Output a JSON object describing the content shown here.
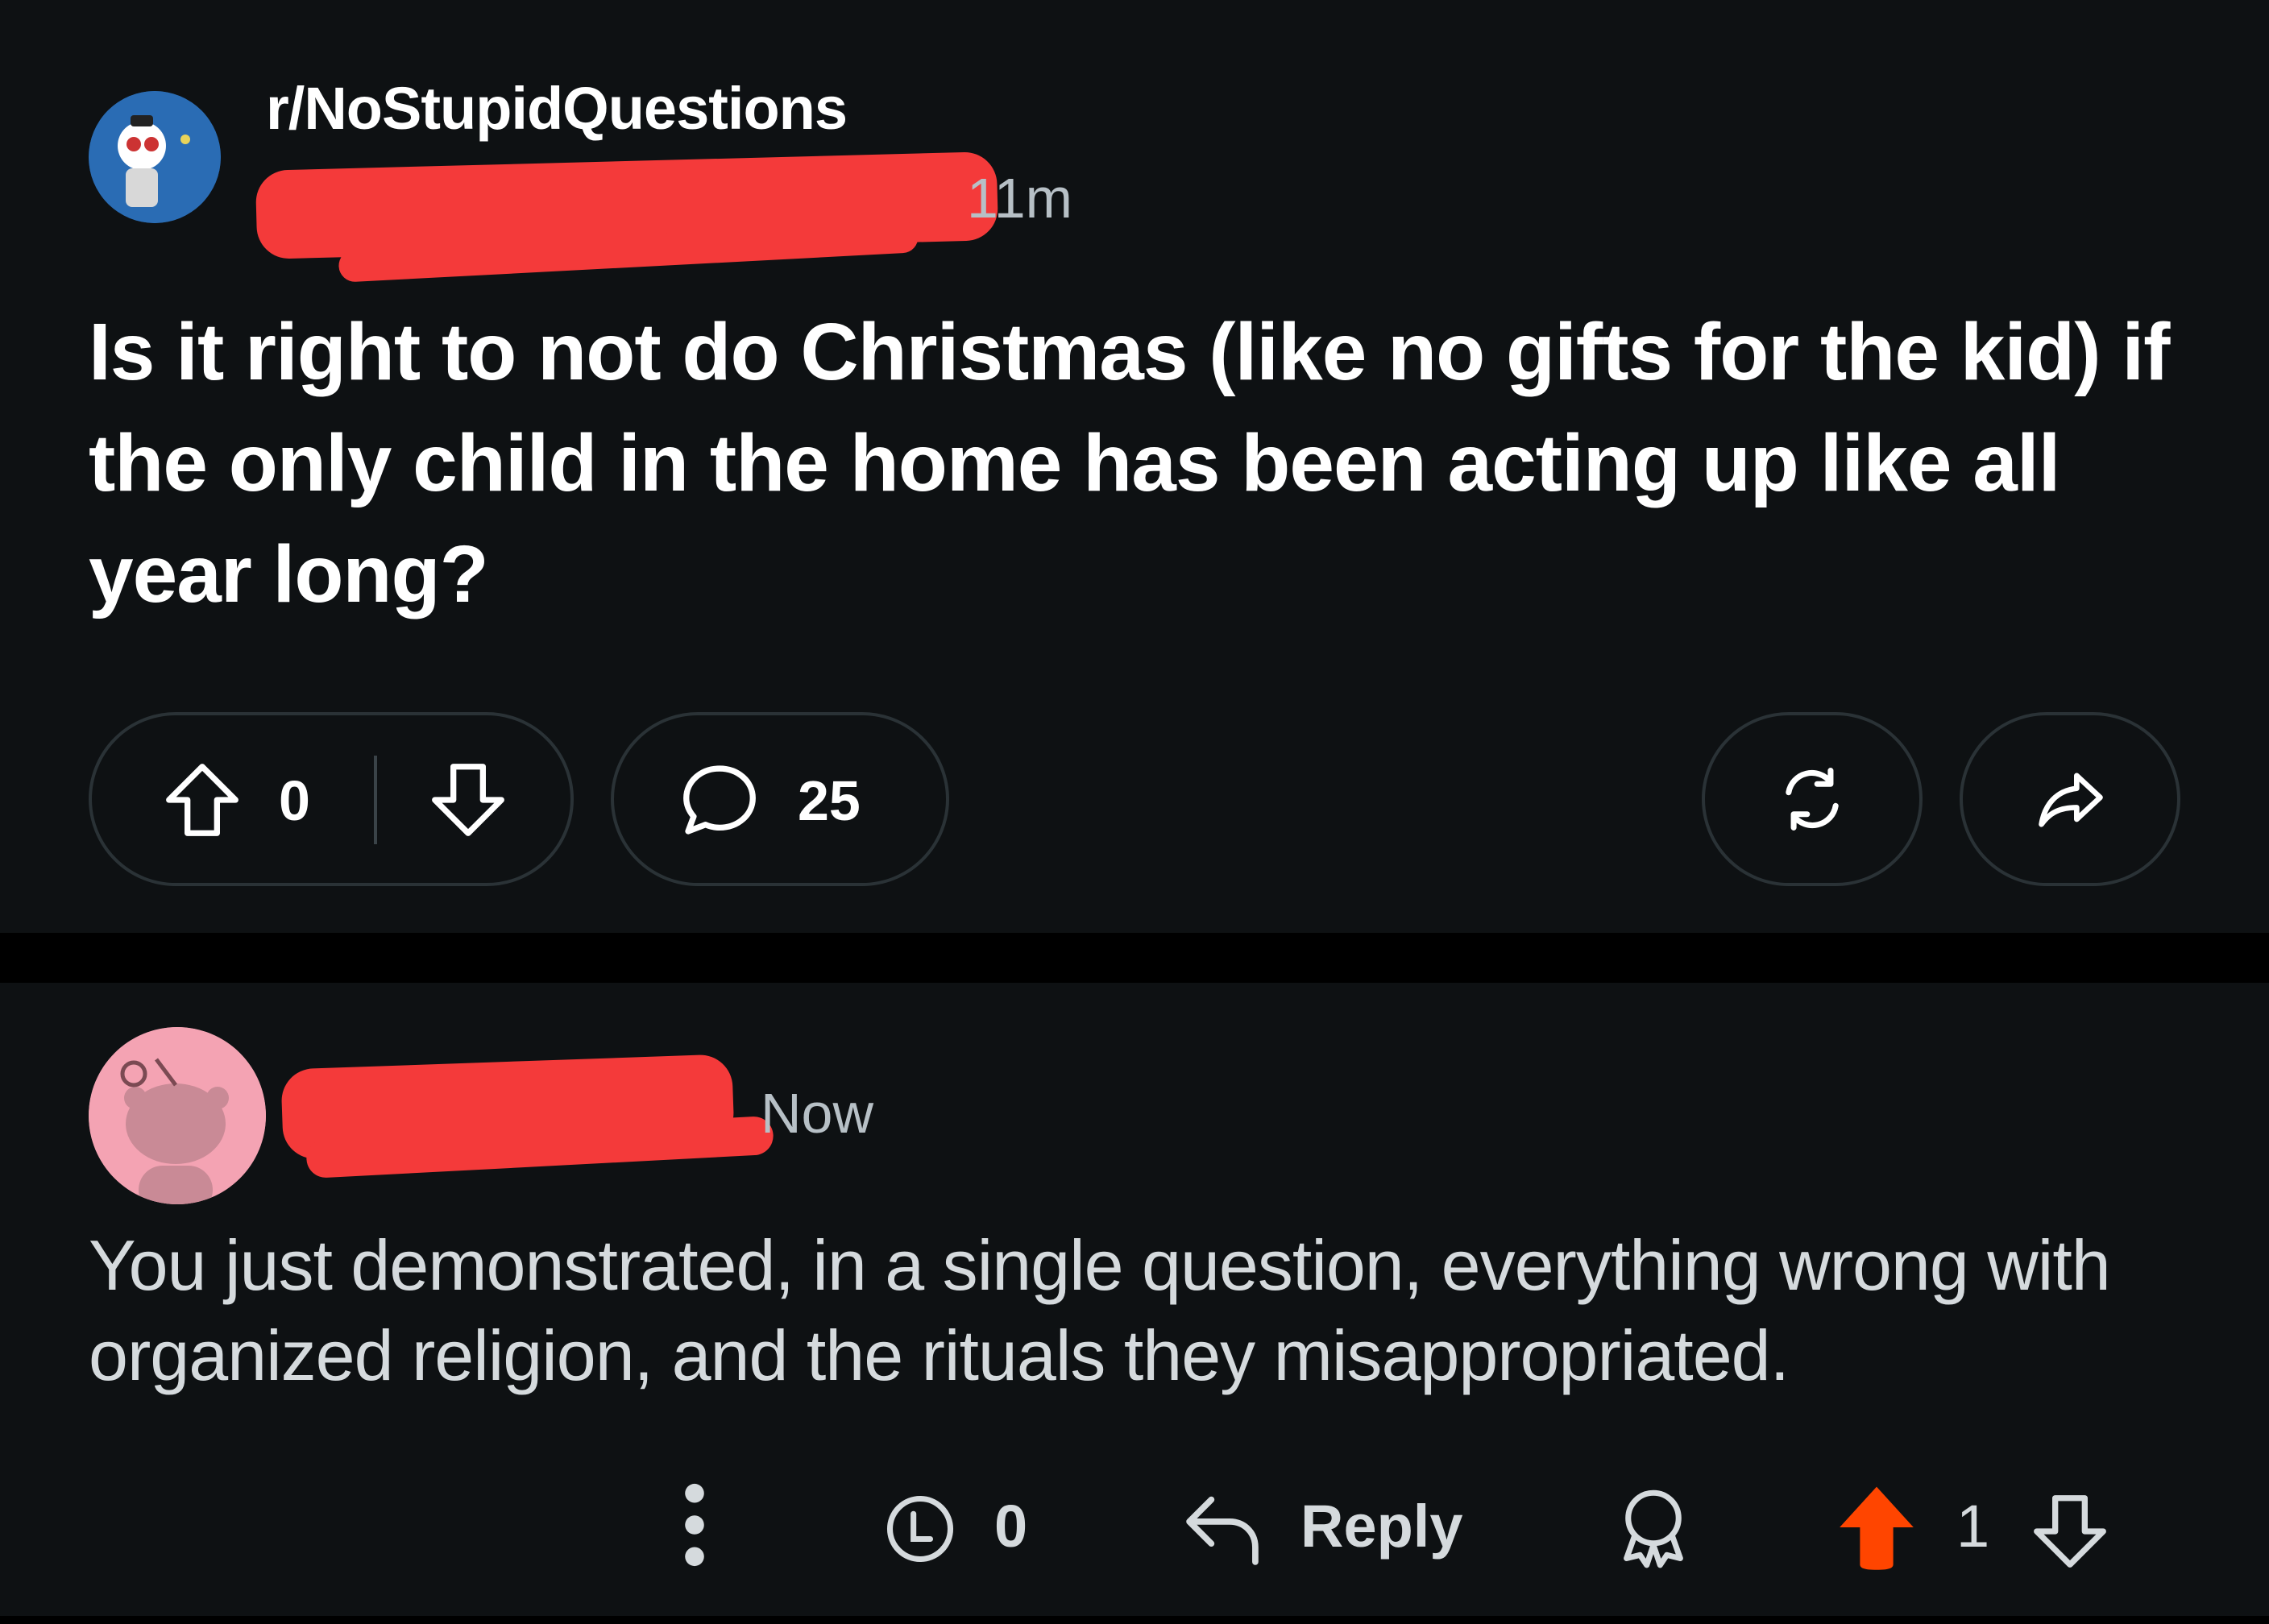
{
  "post": {
    "subreddit": "r/NoStupidQuestions",
    "age": "11m",
    "title": "Is it right to not do Christmas (like no gifts for the kid) if the only child in the home has been acting up like all year long?",
    "upvote_count": "0",
    "comment_count": "25",
    "icons": [
      "upvote-icon",
      "downvote-icon",
      "comment-icon",
      "crosspost-icon",
      "share-icon"
    ]
  },
  "comment": {
    "age": "Now",
    "body": "You just demonstrated, in a single question, everything wrong with organized religion, and the rituals they misappropriated.",
    "award_count": "0",
    "reply_label": "Reply",
    "vote_count": "1",
    "icons": [
      "more-options-icon",
      "award-icon",
      "reply-icon",
      "give-award-icon",
      "upvote-icon",
      "downvote-icon"
    ]
  },
  "colors": {
    "background": "#0e1113",
    "separator": "#000000",
    "redaction": "#f43a3a",
    "upvote_active": "#ff4500",
    "text": "#ffffff",
    "muted_text": "#b7c0c6"
  }
}
